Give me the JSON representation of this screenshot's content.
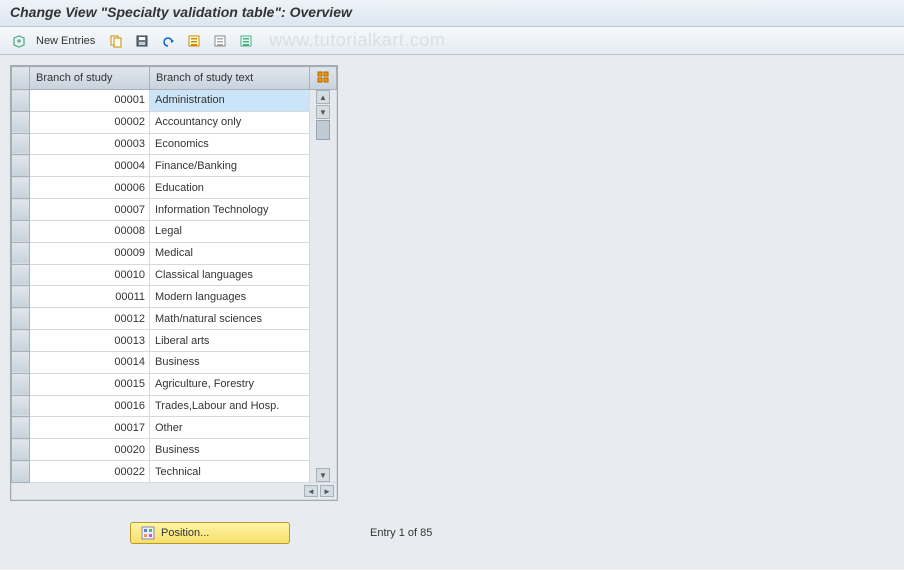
{
  "title": "Change View \"Specialty validation table\": Overview",
  "toolbar": {
    "new_entries": "New Entries"
  },
  "watermark": "www.tutorialkart.com",
  "table": {
    "header_code": "Branch of study",
    "header_text": "Branch of study text",
    "rows": [
      {
        "code": "00001",
        "text": "Administration",
        "selected": true
      },
      {
        "code": "00002",
        "text": "Accountancy only"
      },
      {
        "code": "00003",
        "text": "Economics"
      },
      {
        "code": "00004",
        "text": "Finance/Banking"
      },
      {
        "code": "00006",
        "text": "Education"
      },
      {
        "code": "00007",
        "text": "Information Technology"
      },
      {
        "code": "00008",
        "text": "Legal"
      },
      {
        "code": "00009",
        "text": "Medical"
      },
      {
        "code": "00010",
        "text": "Classical languages"
      },
      {
        "code": "00011",
        "text": "Modern languages"
      },
      {
        "code": "00012",
        "text": "Math/natural sciences"
      },
      {
        "code": "00013",
        "text": "Liberal arts"
      },
      {
        "code": "00014",
        "text": "Business"
      },
      {
        "code": "00015",
        "text": "Agriculture, Forestry"
      },
      {
        "code": "00016",
        "text": "Trades,Labour and Hosp."
      },
      {
        "code": "00017",
        "text": "Other"
      },
      {
        "code": "00020",
        "text": "Business"
      },
      {
        "code": "00022",
        "text": "Technical"
      }
    ]
  },
  "footer": {
    "position_label": "Position...",
    "entry_text": "Entry 1 of 85"
  }
}
